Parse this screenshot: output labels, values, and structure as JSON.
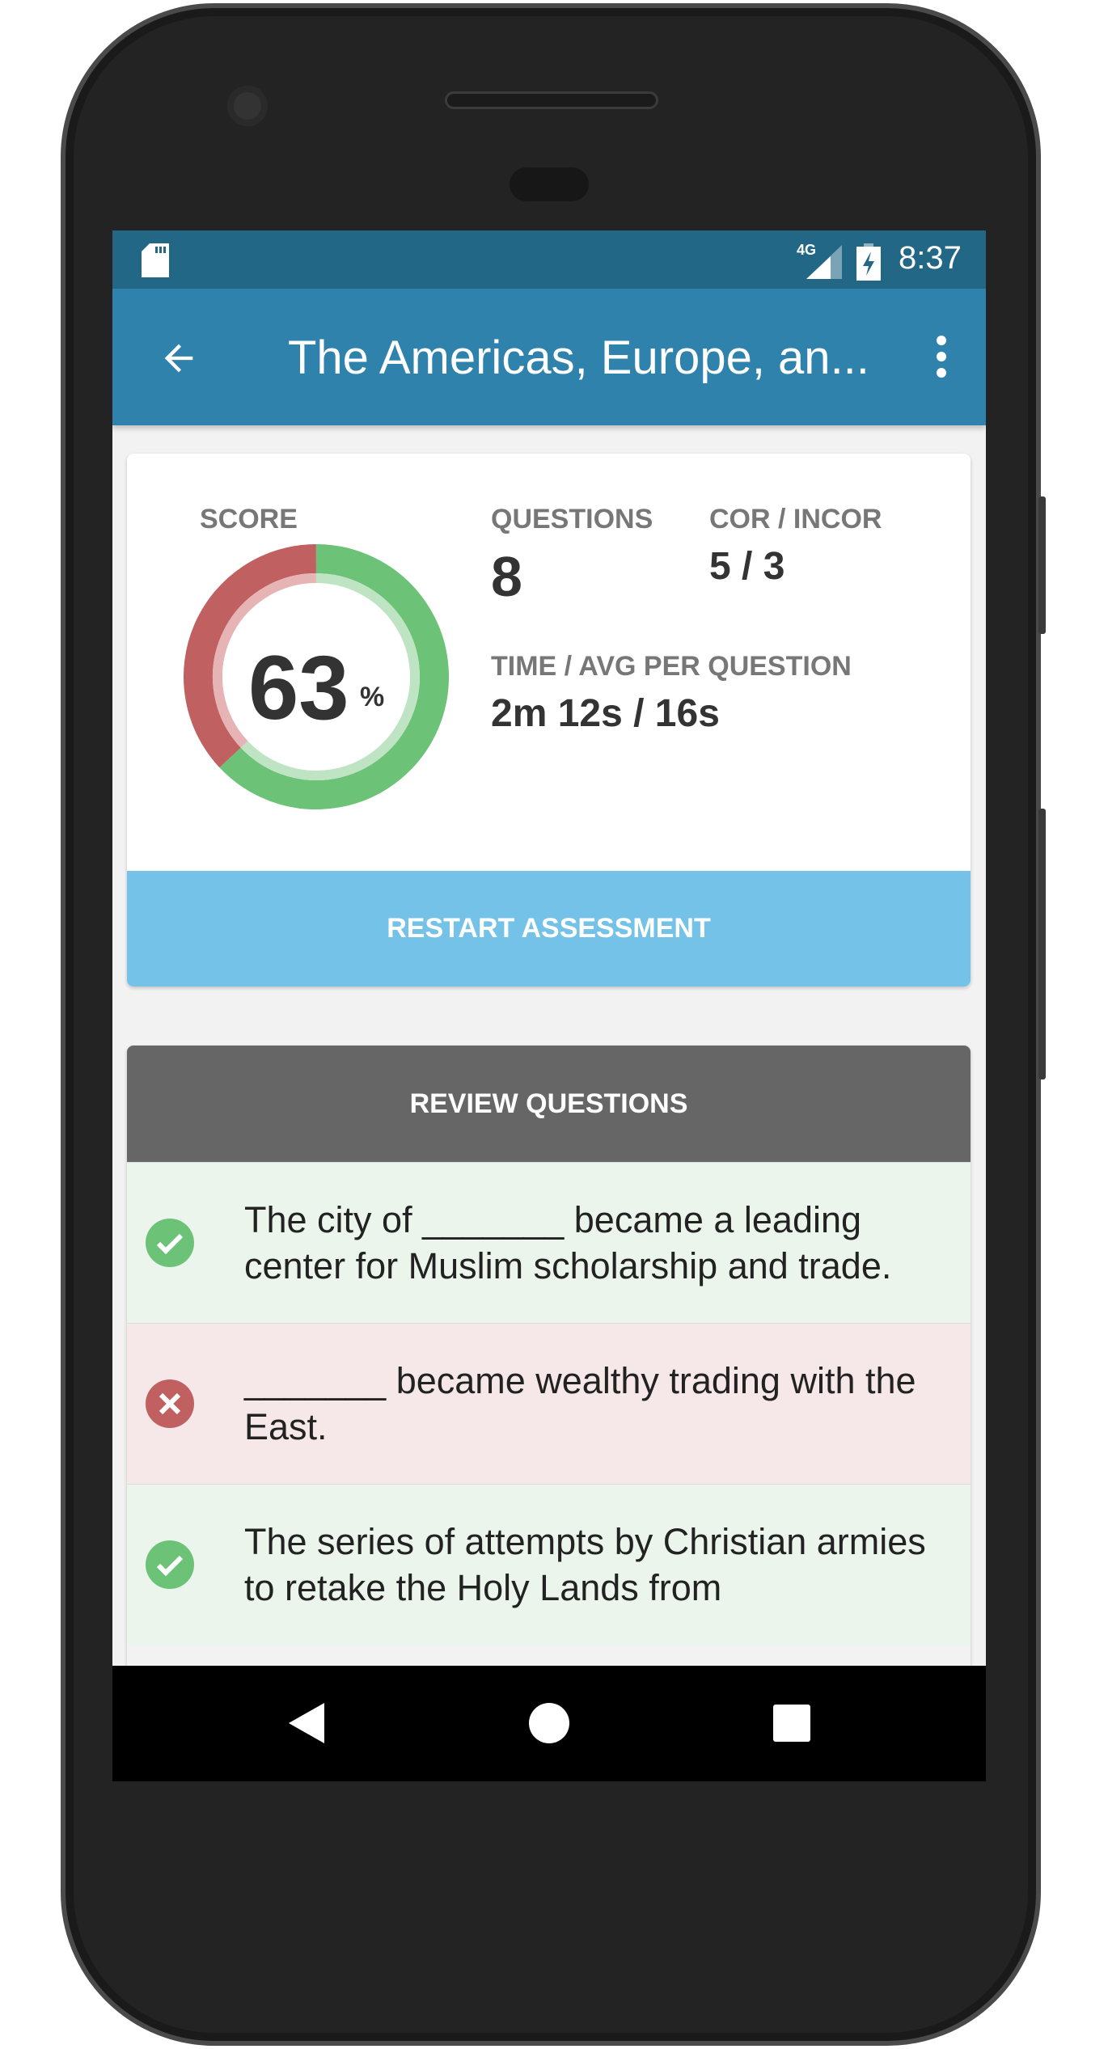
{
  "status_bar": {
    "time": "8:37",
    "network": "4G",
    "icons": [
      "sd-card-icon",
      "signal-icon",
      "battery-charging-icon"
    ]
  },
  "toolbar": {
    "title": "The Americas, Europe, an...",
    "back_icon": "arrow-left-icon",
    "menu_icon": "more-vert-icon"
  },
  "summary": {
    "score_label": "SCORE",
    "score_value": "63",
    "score_unit": "%",
    "score_percent": 63,
    "questions_label": "QUESTIONS",
    "questions_value": "8",
    "cor_incor_label": "COR / INCOR",
    "cor_incor_value": "5 / 3",
    "time_label": "TIME / AVG PER QUESTION",
    "time_value": "2m 12s / 16s",
    "colors": {
      "correct": "#6cc276",
      "incorrect": "#c06060"
    }
  },
  "restart_label": "RESTART ASSESSMENT",
  "review": {
    "header": "REVIEW QUESTIONS",
    "items": [
      {
        "text": "The city of _______ became a leading center for Muslim scholarship and trade.",
        "status": "correct"
      },
      {
        "text": "_______ became wealthy trading with the East.",
        "status": "incorrect"
      },
      {
        "text": "The series of attempts by Christian armies to retake the Holy Lands from",
        "status": "correct"
      }
    ]
  },
  "nav": {
    "icons": [
      "back-triangle-icon",
      "home-circle-icon",
      "recents-square-icon"
    ]
  }
}
